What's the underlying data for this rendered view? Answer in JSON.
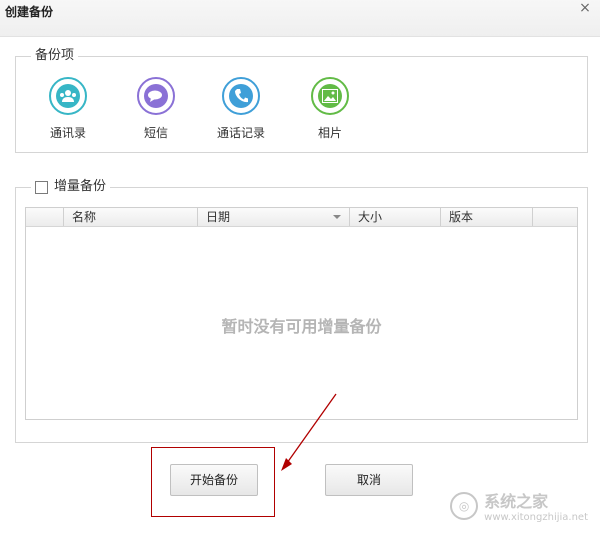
{
  "window": {
    "title": "创建备份",
    "close_glyph": "×"
  },
  "items_group": {
    "legend": "备份项",
    "items": [
      {
        "label": "通讯录",
        "icon": "contacts-icon",
        "color": "#37b6c6"
      },
      {
        "label": "短信",
        "icon": "sms-icon",
        "color": "#8a71d6"
      },
      {
        "label": "通话记录",
        "icon": "call-log-icon",
        "color": "#3f9fd8"
      },
      {
        "label": "相片",
        "icon": "photos-icon",
        "color": "#62bb46"
      }
    ]
  },
  "incremental": {
    "legend": "增量备份",
    "checked": false,
    "columns": [
      "名称",
      "日期",
      "大小",
      "版本"
    ],
    "empty_text": "暂时没有可用增量备份"
  },
  "buttons": {
    "start_label": "开始备份",
    "cancel_label": "取消"
  },
  "watermark": {
    "text": "系统之家",
    "url": "www.xitongzhijia.net"
  },
  "colors": {
    "highlight": "#b10000"
  }
}
